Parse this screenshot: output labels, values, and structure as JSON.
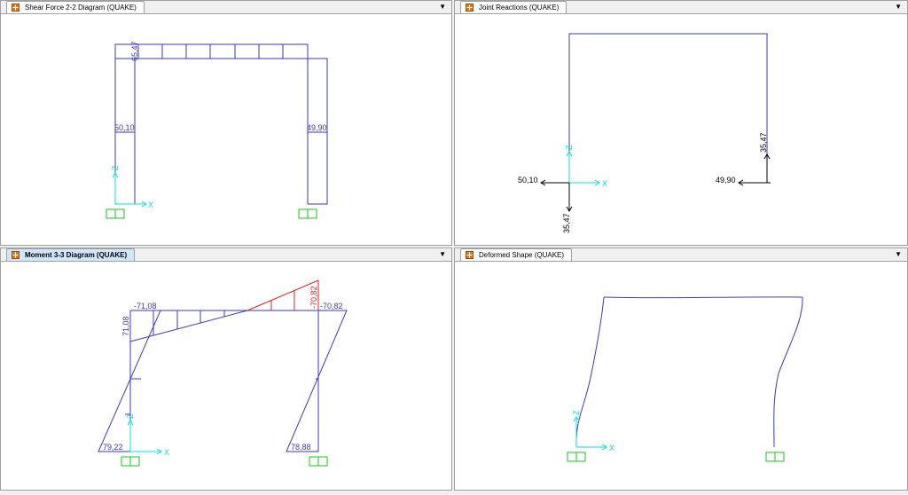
{
  "colors": {
    "structure": "#3a3ab8",
    "negative": "#e02020",
    "axes": "#00e6e6",
    "support": "#11cc11",
    "reaction_arrow": "#000000",
    "active_tab": "#cfe6fb"
  },
  "panes": {
    "shear": {
      "title": "Shear Force 2-2 Diagram   (QUAKE)",
      "labels": {
        "beam_value": "65,47",
        "left_col": "50,10",
        "right_col": "49,90"
      },
      "axes": {
        "x": "X",
        "z": "Z"
      }
    },
    "reactions": {
      "title": "Joint Reactions   (QUAKE)",
      "labels": {
        "left_horizontal": "50,10",
        "left_vertical": "35,47",
        "right_horizontal": "49,90",
        "right_vertical": "35,47"
      },
      "axes": {
        "x": "X",
        "z": "Z"
      }
    },
    "moment": {
      "title": "Moment 3-3 Diagram   (QUAKE)",
      "labels": {
        "beam_left": "-71,08",
        "left_col_top": "71,08",
        "beam_right_peak": "-70,82",
        "right_col_top": "-70,82",
        "left_col_base": "79,22",
        "right_col_base": "78,88"
      },
      "axes": {
        "x": "X",
        "z": "Z"
      }
    },
    "deformed": {
      "title": "Deformed Shape (QUAKE)",
      "axes": {
        "x": "X",
        "z": "Z"
      }
    }
  },
  "icons": {
    "tab": "sap-app-icon",
    "dropdown": "chevron-down-icon"
  }
}
